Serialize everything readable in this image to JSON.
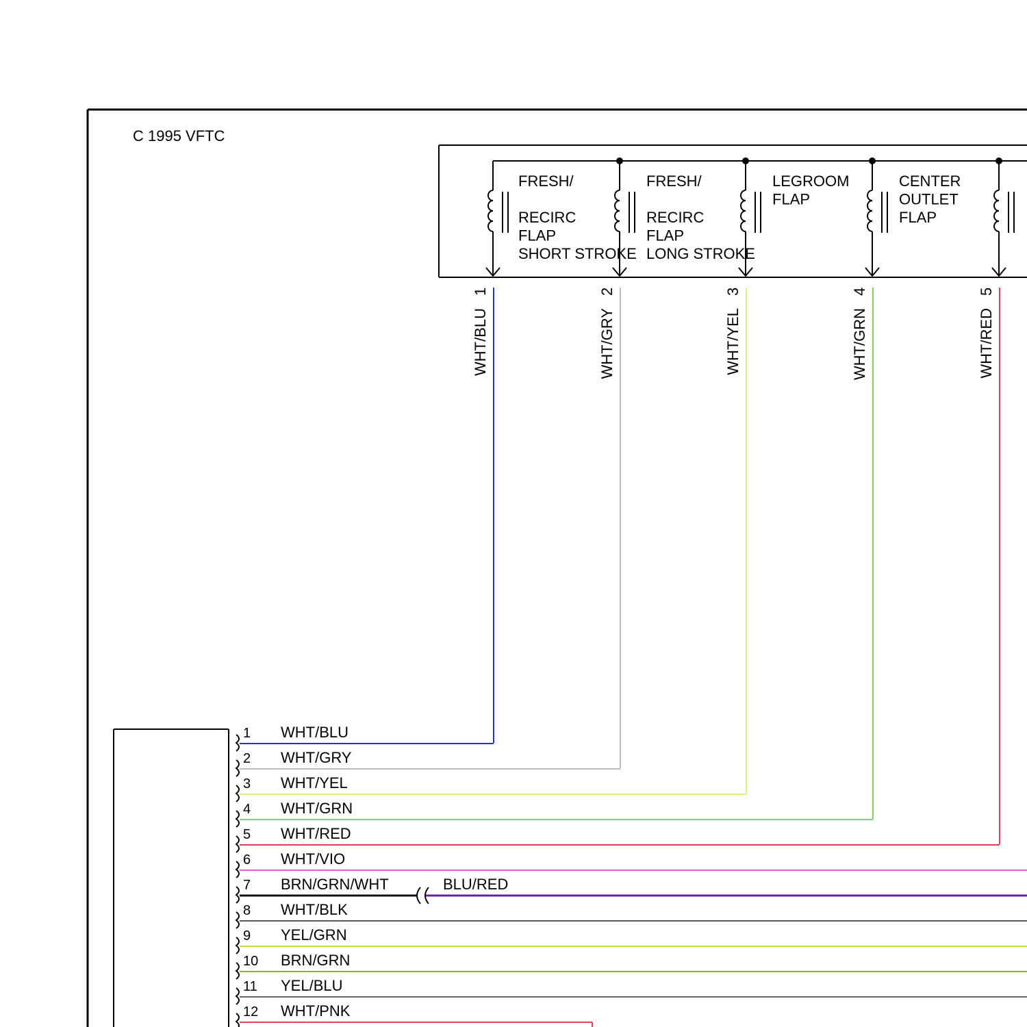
{
  "copyright": "C  1995 VFTC",
  "flaps": [
    {
      "pin": "1",
      "wire": "WHT/BLU",
      "label_lines": [
        "FRESH/",
        "",
        "RECIRC",
        "FLAP",
        "SHORT STROKE"
      ],
      "color": "#2b2bd4"
    },
    {
      "pin": "2",
      "wire": "WHT/GRY",
      "label_lines": [
        "FRESH/",
        "",
        "RECIRC",
        "FLAP",
        "LONG STROKE"
      ],
      "color": "#bdbdbd"
    },
    {
      "pin": "3",
      "wire": "WHT/YEL",
      "label_lines": [
        "LEGROOM",
        "FLAP"
      ],
      "color": "#e2ef7a"
    },
    {
      "pin": "4",
      "wire": "WHT/GRN",
      "label_lines": [
        "CENTER",
        "OUTLET",
        "FLAP"
      ],
      "color": "#7fd06a"
    },
    {
      "pin": "5",
      "wire": "WHT/RED",
      "label_lines": [],
      "color": "#e0404f"
    }
  ],
  "connector_rows": [
    {
      "pin": "1",
      "wire": "WHT/BLU",
      "color": "#2b2bd4"
    },
    {
      "pin": "2",
      "wire": "WHT/GRY",
      "color": "#bdbdbd"
    },
    {
      "pin": "3",
      "wire": "WHT/YEL",
      "color": "#e2ef7a"
    },
    {
      "pin": "4",
      "wire": "WHT/GRN",
      "color": "#7fd06a"
    },
    {
      "pin": "5",
      "wire": "WHT/RED",
      "color": "#e0404f"
    },
    {
      "pin": "6",
      "wire": "WHT/VIO",
      "color": "#e060d8"
    },
    {
      "pin": "7",
      "wire": "BRN/GRN/WHT",
      "color": "#111111",
      "splice_wire": "BLU/RED",
      "splice_color": "#6a1fa8"
    },
    {
      "pin": "8",
      "wire": "WHT/BLK",
      "color": "#555555"
    },
    {
      "pin": "9",
      "wire": "YEL/GRN",
      "color": "#b8e23a"
    },
    {
      "pin": "10",
      "wire": "BRN/GRN",
      "color": "#8fb22a"
    },
    {
      "pin": "11",
      "wire": "YEL/BLU",
      "color": "#666666"
    },
    {
      "pin": "12",
      "wire": "WHT/PNK",
      "color": "#e0405a"
    }
  ]
}
